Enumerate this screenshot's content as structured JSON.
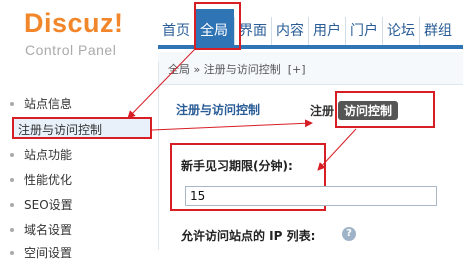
{
  "logo": {
    "title": "Discuz!",
    "subtitle": "Control Panel"
  },
  "nav": {
    "items": [
      {
        "label": "首页"
      },
      {
        "label": "全局",
        "active": true
      },
      {
        "label": "界面"
      },
      {
        "label": "内容"
      },
      {
        "label": "用户"
      },
      {
        "label": "门户"
      },
      {
        "label": "论坛"
      },
      {
        "label": "群组"
      }
    ]
  },
  "breadcrumb": {
    "text": "全局 » 注册与访问控制",
    "add": "[+]"
  },
  "sidebar": {
    "items": [
      {
        "label": "站点信息"
      },
      {
        "label": "注册与访问控制",
        "active": true
      },
      {
        "label": "站点功能"
      },
      {
        "label": "性能优化"
      },
      {
        "label": "SEO设置"
      },
      {
        "label": "域名设置"
      },
      {
        "label": "空间设置"
      }
    ]
  },
  "main": {
    "title": "注册与访问控制",
    "tabs": [
      {
        "label": "注册"
      },
      {
        "label": "访问控制",
        "active": true
      }
    ],
    "field_1": {
      "label": "新手见习期限(分钟):",
      "value": "15"
    },
    "field_2": {
      "label": "允许访问站点的 IP 列表:"
    }
  },
  "colors": {
    "brand_orange": "#f2862b",
    "nav_blue": "#2f74b5",
    "annotation_red": "#d81e25"
  }
}
